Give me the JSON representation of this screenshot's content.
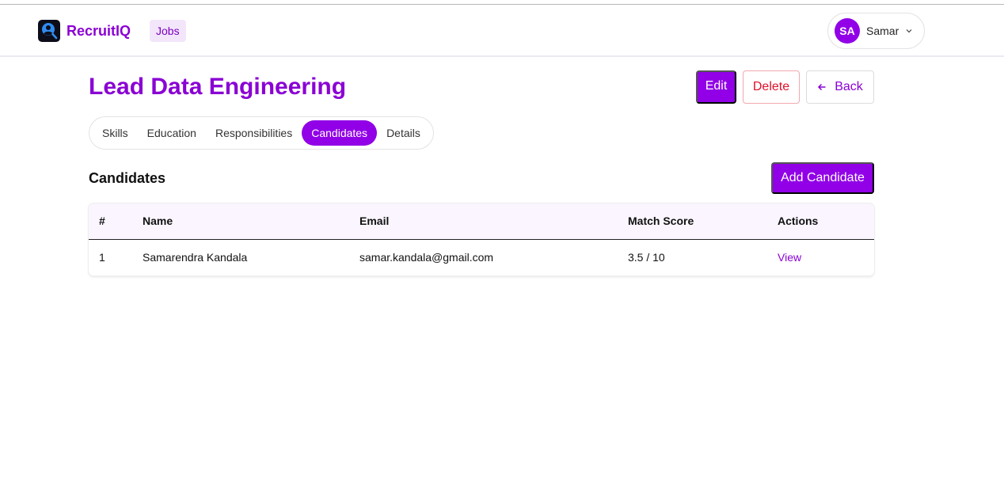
{
  "brand": {
    "name": "RecruitIQ"
  },
  "nav": {
    "jobs_label": "Jobs"
  },
  "user": {
    "initials": "SA",
    "name": "Samar"
  },
  "page": {
    "title": "Lead Data Engineering"
  },
  "actions": {
    "edit_label": "Edit",
    "delete_label": "Delete",
    "back_label": "Back"
  },
  "tabs": [
    {
      "label": "Skills",
      "active": false
    },
    {
      "label": "Education",
      "active": false
    },
    {
      "label": "Responsibilities",
      "active": false
    },
    {
      "label": "Candidates",
      "active": true
    },
    {
      "label": "Details",
      "active": false
    }
  ],
  "candidates": {
    "title": "Candidates",
    "add_label": "Add Candidate",
    "columns": [
      "#",
      "Name",
      "Email",
      "Match Score",
      "Actions"
    ],
    "rows": [
      {
        "index": "1",
        "name": "Samarendra Kandala",
        "email": "samar.kandala@gmail.com",
        "score": "3.5 / 10",
        "action": "View"
      }
    ]
  },
  "colors": {
    "accent": "#9100e6",
    "brand_text": "#8a00d4",
    "danger": "#e0102a"
  }
}
